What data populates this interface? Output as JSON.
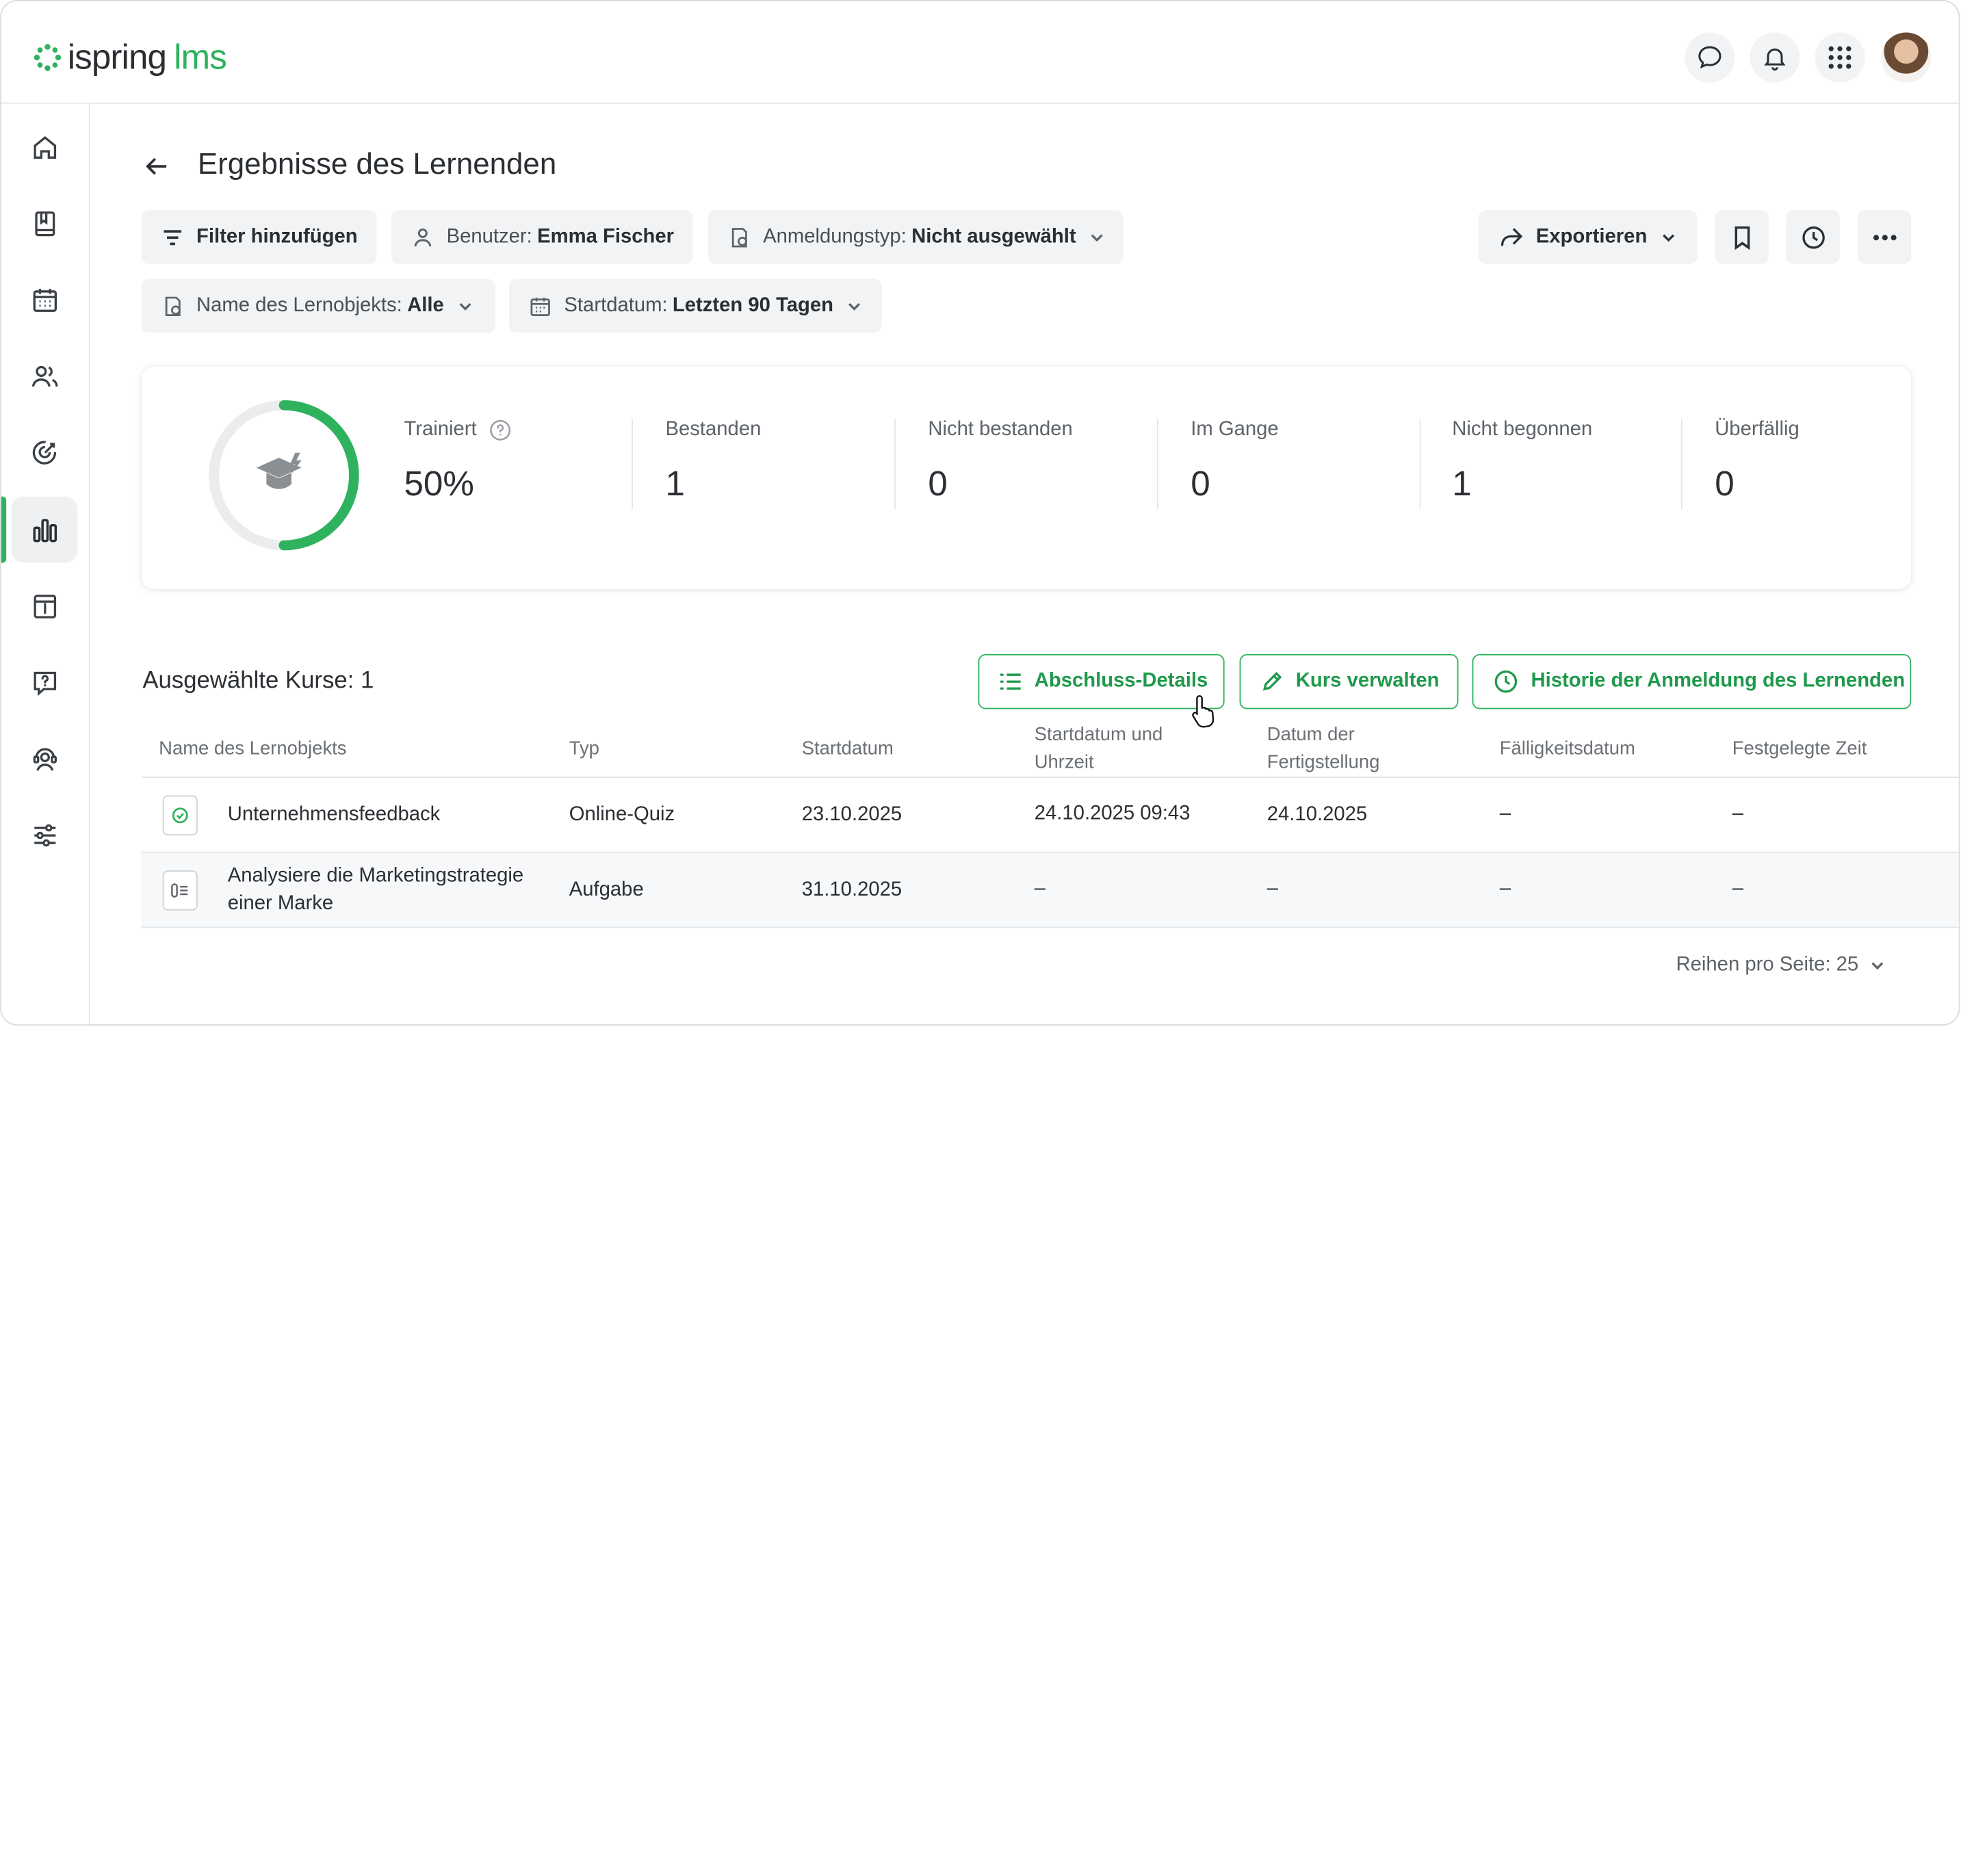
{
  "app": {
    "brand": "ispring",
    "product": "lms"
  },
  "header": {
    "icons": [
      "chat-icon",
      "bell-icon",
      "apps-grid-icon"
    ],
    "avatar": "avatar"
  },
  "sidebar": {
    "items": [
      {
        "icon": "home-icon"
      },
      {
        "icon": "book-icon"
      },
      {
        "icon": "calendar-icon"
      },
      {
        "icon": "users-icon"
      },
      {
        "icon": "target-icon"
      },
      {
        "icon": "reports-icon",
        "active": true
      },
      {
        "icon": "info-icon"
      },
      {
        "icon": "question-icon"
      },
      {
        "icon": "support-icon"
      },
      {
        "icon": "settings-sliders-icon"
      }
    ]
  },
  "page": {
    "title": "Ergebnisse des Lernenden"
  },
  "filters": {
    "add_filter": "Filter hinzufügen",
    "user_key": "Benutzer:",
    "user_value": "Emma Fischer",
    "enroll_key": "Anmeldungstyp:",
    "enroll_value": "Nicht ausgewählt",
    "object_key": "Name des Lernobjekts:",
    "object_value": "Alle",
    "date_key": "Startdatum:",
    "date_value": "Letzten 90 Tagen"
  },
  "toolbar": {
    "export": "Exportieren"
  },
  "stats": {
    "trained_label": "Trainiert",
    "trained_value": "50%",
    "trained_fraction": 0.5,
    "passed_label": "Bestanden",
    "passed_value": "1",
    "failed_label": "Nicht bestanden",
    "failed_value": "0",
    "in_progress_label": "Im Gange",
    "in_progress_value": "0",
    "not_started_label": "Nicht begonnen",
    "not_started_value": "1",
    "overdue_label": "Überfällig",
    "overdue_value": "0",
    "accent": "#2eb25e"
  },
  "courses": {
    "selected_label": "Ausgewählte Kurse: 1",
    "buttons": {
      "completion": "Abschluss-Details",
      "manage": "Kurs verwalten",
      "history": "Historie der Anmeldung des Lernenden"
    },
    "columns": {
      "name": "Name des Lernobjekts",
      "type": "Typ",
      "start": "Startdatum",
      "start_time_1": "Startdatum und",
      "start_time_2": "Uhrzeit",
      "completed_1": "Datum der",
      "completed_2": "Fertigstellung",
      "due": "Fälligkeitsdatum",
      "fixed_time": "Festgelegte Zeit"
    },
    "rows": [
      {
        "name": "Unternehmensfeedback",
        "type": "Online-Quiz",
        "start": "23.10.2025",
        "start_time": "24.10.2025 09:43",
        "completed": "24.10.2025",
        "due": "–",
        "fixed_time": "–"
      },
      {
        "name_1": "Analysiere die Marketingstrategie",
        "name_2": "einer Marke",
        "type": "Aufgabe",
        "start": "31.10.2025",
        "start_time": "–",
        "completed": "–",
        "due": "–",
        "fixed_time": "–"
      }
    ],
    "rows_per_page": "Reihen pro Seite: 25"
  }
}
